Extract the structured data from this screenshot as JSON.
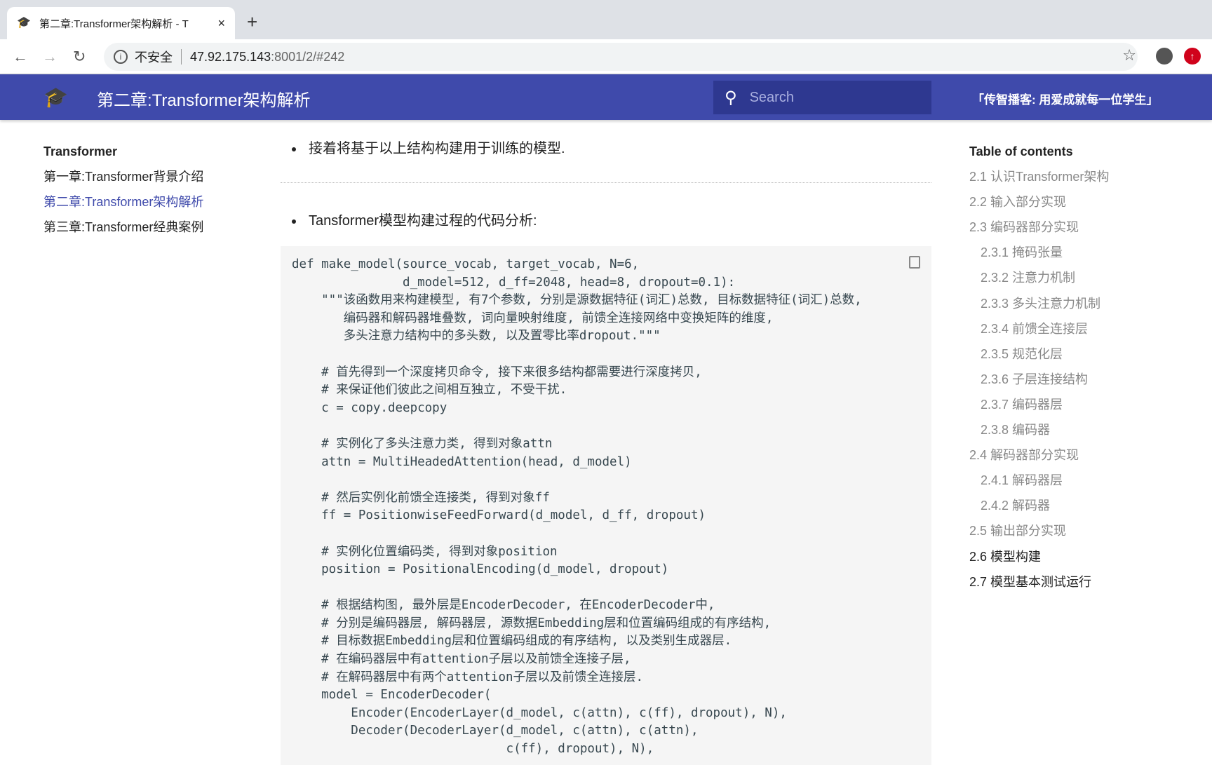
{
  "browser": {
    "tab_title": "第二章:Transformer架构解析 - T",
    "new_tab": "+",
    "close": "×",
    "security_label": "不安全",
    "url_host": "47.92.175.143",
    "url_path": ":8001/2/#242"
  },
  "header": {
    "title": "第二章:Transformer架构解析",
    "search_placeholder": "Search",
    "slogan": "「传智播客: 用爱成就每一位学生」",
    "color": "#3f4aab"
  },
  "sidebar": {
    "heading": "Transformer",
    "items": [
      {
        "label": "第一章:Transformer背景介绍"
      },
      {
        "label": "第二章:Transformer架构解析",
        "active": true
      },
      {
        "label": "第三章:Transformer经典案例"
      }
    ]
  },
  "main": {
    "bullet1": "接着将基于以上结构构建用于训练的模型.",
    "bullet2": "Tansformer模型构建过程的代码分析:",
    "code_lines": [
      "def make_model(source_vocab, target_vocab, N=6,",
      "               d_model=512, d_ff=2048, head=8, dropout=0.1):",
      "    \"\"\"该函数用来构建模型, 有7个参数, 分别是源数据特征(词汇)总数, 目标数据特征(词汇)总数,",
      "       编码器和解码器堆叠数, 词向量映射维度, 前馈全连接网络中变换矩阵的维度,",
      "       多头注意力结构中的多头数, 以及置零比率dropout.\"\"\"",
      "",
      "    # 首先得到一个深度拷贝命令, 接下来很多结构都需要进行深度拷贝,",
      "    # 来保证他们彼此之间相互独立, 不受干扰.",
      "    c = copy.deepcopy",
      "",
      "    # 实例化了多头注意力类, 得到对象attn",
      "    attn = MultiHeadedAttention(head, d_model)",
      "",
      "    # 然后实例化前馈全连接类, 得到对象ff",
      "    ff = PositionwiseFeedForward(d_model, d_ff, dropout)",
      "",
      "    # 实例化位置编码类, 得到对象position",
      "    position = PositionalEncoding(d_model, dropout)",
      "",
      "    # 根据结构图, 最外层是EncoderDecoder, 在EncoderDecoder中,",
      "    # 分别是编码器层, 解码器层, 源数据Embedding层和位置编码组成的有序结构,",
      "    # 目标数据Embedding层和位置编码组成的有序结构, 以及类别生成器层.",
      "    # 在编码器层中有attention子层以及前馈全连接子层,",
      "    # 在解码器层中有两个attention子层以及前馈全连接层.",
      "    model = EncoderDecoder(",
      "        Encoder(EncoderLayer(d_model, c(attn), c(ff), dropout), N),",
      "        Decoder(DecoderLayer(d_model, c(attn), c(attn),",
      "                             c(ff), dropout), N),"
    ]
  },
  "toc": {
    "heading": "Table of contents",
    "items": [
      {
        "label": "2.1 认识Transformer架构",
        "level": 1
      },
      {
        "label": "2.2 输入部分实现",
        "level": 1
      },
      {
        "label": "2.3 编码器部分实现",
        "level": 1
      },
      {
        "label": "2.3.1 掩码张量",
        "level": 2
      },
      {
        "label": "2.3.2 注意力机制",
        "level": 2
      },
      {
        "label": "2.3.3 多头注意力机制",
        "level": 2
      },
      {
        "label": "2.3.4 前馈全连接层",
        "level": 2
      },
      {
        "label": "2.3.5 规范化层",
        "level": 2
      },
      {
        "label": "2.3.6 子层连接结构",
        "level": 2
      },
      {
        "label": "2.3.7 编码器层",
        "level": 2
      },
      {
        "label": "2.3.8 编码器",
        "level": 2
      },
      {
        "label": "2.4 解码器部分实现",
        "level": 1
      },
      {
        "label": "2.4.1 解码器层",
        "level": 2
      },
      {
        "label": "2.4.2 解码器",
        "level": 2
      },
      {
        "label": "2.5 输出部分实现",
        "level": 1
      },
      {
        "label": "2.6 模型构建",
        "level": 1,
        "current": true
      },
      {
        "label": "2.7 模型基本测试运行",
        "level": 1,
        "current": true
      }
    ]
  }
}
